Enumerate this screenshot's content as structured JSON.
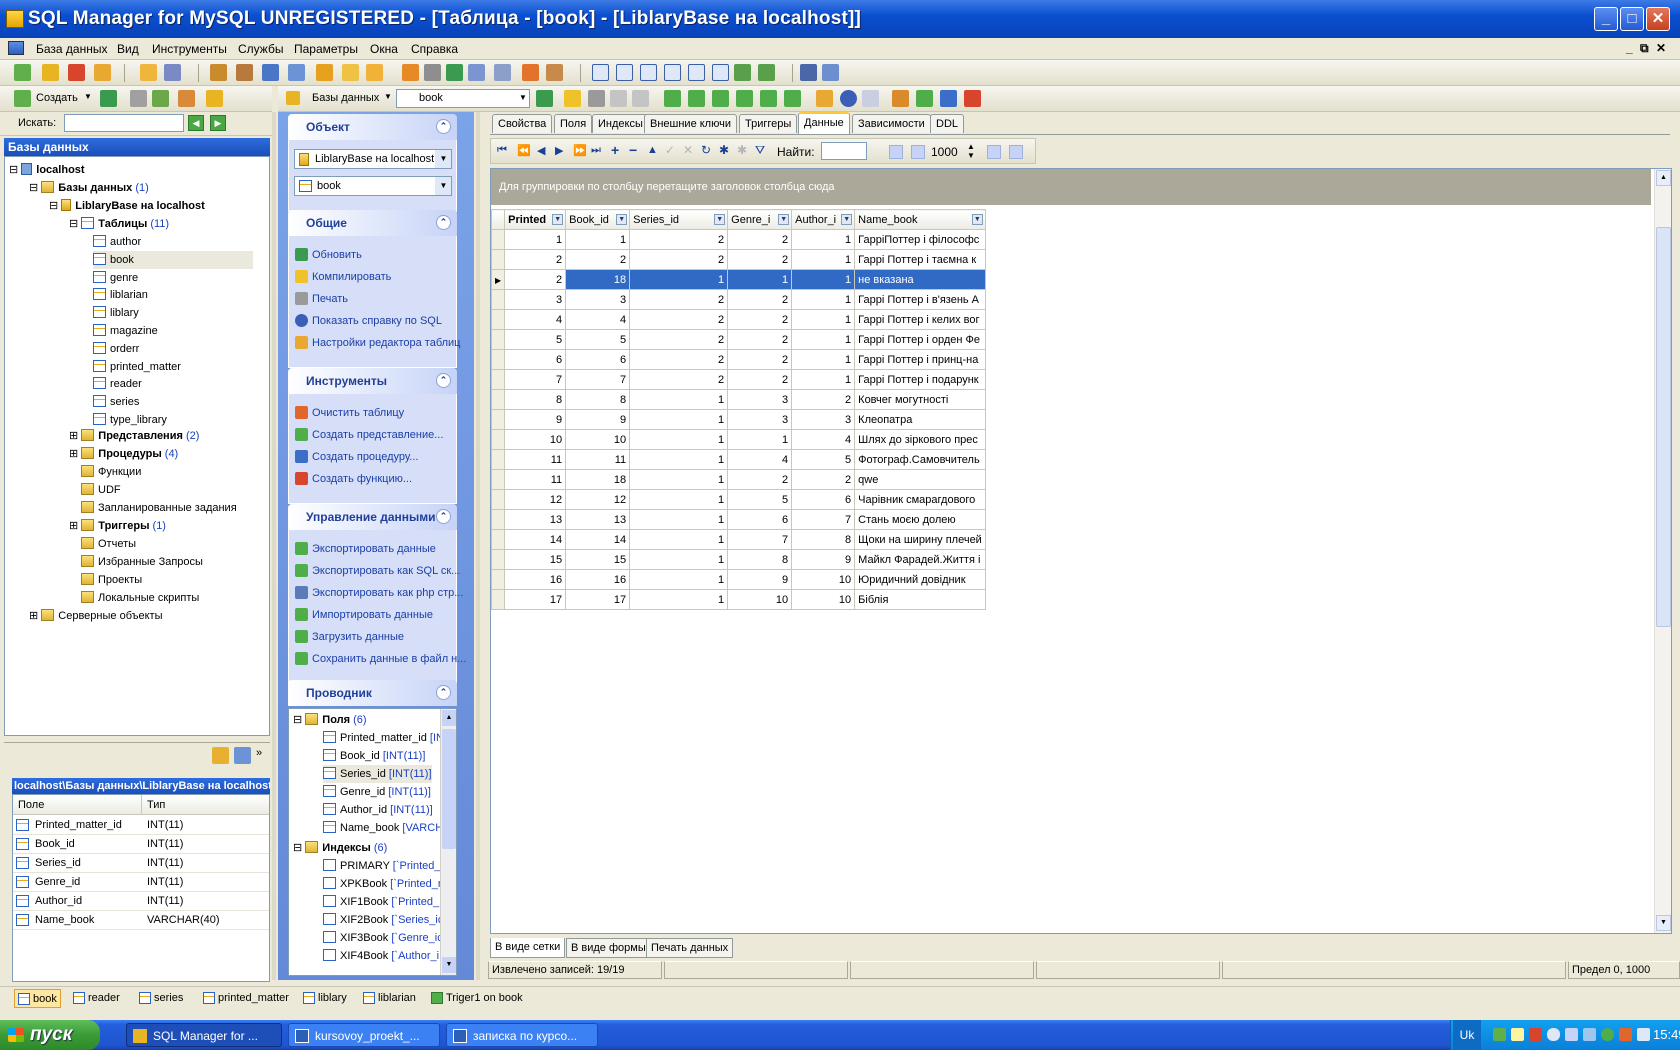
{
  "window": {
    "title": "SQL Manager for MySQL UNREGISTERED - [Таблица - [book] - [LiblaryBase на localhost]]"
  },
  "menu": [
    "База данных",
    "Вид",
    "Инструменты",
    "Службы",
    "Параметры",
    "Окна",
    "Справка"
  ],
  "toolbar2": {
    "create_label": "Создать",
    "db_select": "Базы данных",
    "table_select": "book"
  },
  "search": {
    "label": "Искать:",
    "value": ""
  },
  "db_panel": {
    "title": "Базы данных",
    "tree": {
      "host": "localhost",
      "databases": "Базы данных",
      "databases_count": "(1)",
      "db": "LiblaryBase на localhost",
      "tables": "Таблицы",
      "tables_count": "(11)",
      "table_list": [
        "author",
        "book",
        "genre",
        "liblarian",
        "liblary",
        "magazine",
        "orderr",
        "printed_matter",
        "reader",
        "series",
        "type_library"
      ],
      "views": "Представления",
      "views_count": "(2)",
      "procedures": "Процедуры",
      "procedures_count": "(4)",
      "functions": "Функции",
      "udf": "UDF",
      "scheduled": "Запланированные задания",
      "triggers": "Триггеры",
      "triggers_count": "(1)",
      "reports": "Отчеты",
      "favorites": "Избранные Запросы",
      "projects": "Проекты",
      "scripts": "Локальные скрипты",
      "server_objects": "Серверные объекты"
    }
  },
  "fields_panel": {
    "path": "localhost\\Базы данных\\LiblaryBase на localhost",
    "col_field": "Поле",
    "col_type": "Тип",
    "rows": [
      {
        "name": "Printed_matter_id",
        "type": "INT(11)"
      },
      {
        "name": "Book_id",
        "type": "INT(11)"
      },
      {
        "name": "Series_id",
        "type": "INT(11)"
      },
      {
        "name": "Genre_id",
        "type": "INT(11)"
      },
      {
        "name": "Author_id",
        "type": "INT(11)"
      },
      {
        "name": "Name_book",
        "type": "VARCHAR(40)"
      }
    ]
  },
  "taskpane": {
    "object": {
      "title": "Объект",
      "db": "LiblaryBase на localhost",
      "table": "book"
    },
    "general": {
      "title": "Общие",
      "links": [
        "Обновить",
        "Компилировать",
        "Печать",
        "Показать справку по  SQL",
        "Настройки редактора таблиц"
      ]
    },
    "tools": {
      "title": "Инструменты",
      "links": [
        "Очистить таблицу",
        "Создать представление...",
        "Создать процедуру...",
        "Создать функцию..."
      ]
    },
    "data": {
      "title": "Управление данными",
      "links": [
        "Экспортировать данные",
        "Экспортировать как SQL ск...",
        "Экспортировать как php стр...",
        "Импортировать данные",
        "Загрузить данные",
        "Сохранить данные в файл н..."
      ]
    },
    "explorer": {
      "title": "Проводник",
      "fields_label": "Поля",
      "fields_count": "(6)",
      "fields": [
        {
          "name": "Printed_matter_id",
          "type": "[IN"
        },
        {
          "name": "Book_id",
          "type": "[INT(11)]"
        },
        {
          "name": "Series_id",
          "type": "[INT(11)]"
        },
        {
          "name": "Genre_id",
          "type": "[INT(11)]"
        },
        {
          "name": "Author_id",
          "type": "[INT(11)]"
        },
        {
          "name": "Name_book",
          "type": "[VARCH"
        }
      ],
      "indexes_label": "Индексы",
      "indexes_count": "(6)",
      "indexes": [
        {
          "name": "PRIMARY",
          "cols": "[`Printed_"
        },
        {
          "name": "XPKBook",
          "cols": "[`Printed_r"
        },
        {
          "name": "XIF1Book",
          "cols": "[`Printed_"
        },
        {
          "name": "XIF2Book",
          "cols": "[`Series_ic"
        },
        {
          "name": "XIF3Book",
          "cols": "[`Genre_ic"
        },
        {
          "name": "XIF4Book",
          "cols": "[`Author_i"
        }
      ]
    }
  },
  "tabs": [
    "Свойства",
    "Поля",
    "Индексы",
    "Внешние ключи",
    "Триггеры",
    "Данные",
    "Зависимости",
    "DDL"
  ],
  "active_tab": "Данные",
  "nav": {
    "find_label": "Найти:",
    "find_value": "",
    "limit": "1000"
  },
  "grid": {
    "group_hint": "Для группировки по столбцу перетащите заголовок столбца сюда",
    "columns": [
      "Printed",
      "Book_id",
      "Series_id",
      "Genre_i",
      "Author_i",
      "Name_book"
    ],
    "rows": [
      [
        "1",
        "1",
        "2",
        "2",
        "1",
        "ГарріПоттер і філософс"
      ],
      [
        "2",
        "2",
        "2",
        "2",
        "1",
        "Гаррі Поттер і таємна к"
      ],
      [
        "2",
        "18",
        "1",
        "1",
        "1",
        "не вказана"
      ],
      [
        "3",
        "3",
        "2",
        "2",
        "1",
        "Гаррі Поттер і в'язень А"
      ],
      [
        "4",
        "4",
        "2",
        "2",
        "1",
        "Гаррі Поттер і келих вог"
      ],
      [
        "5",
        "5",
        "2",
        "2",
        "1",
        "Гаррі Поттер і орден Фе"
      ],
      [
        "6",
        "6",
        "2",
        "2",
        "1",
        "Гаррі Поттер і принц-на"
      ],
      [
        "7",
        "7",
        "2",
        "2",
        "1",
        "Гаррі Поттер і подарунк"
      ],
      [
        "8",
        "8",
        "1",
        "3",
        "2",
        "Ковчег могутності"
      ],
      [
        "9",
        "9",
        "1",
        "3",
        "3",
        "Клеопатра"
      ],
      [
        "10",
        "10",
        "1",
        "1",
        "4",
        "Шлях до зіркового прес"
      ],
      [
        "11",
        "11",
        "1",
        "4",
        "5",
        "Фотограф.Самовчитель"
      ],
      [
        "11",
        "18",
        "1",
        "2",
        "2",
        "qwe"
      ],
      [
        "12",
        "12",
        "1",
        "5",
        "6",
        "Чарівник смарагдового"
      ],
      [
        "13",
        "13",
        "1",
        "6",
        "7",
        "Стань моєю долею"
      ],
      [
        "14",
        "14",
        "1",
        "7",
        "8",
        "Щоки на ширину плечей"
      ],
      [
        "15",
        "15",
        "1",
        "8",
        "9",
        "Майкл Фарадей.Життя і"
      ],
      [
        "16",
        "16",
        "1",
        "9",
        "10",
        "Юридичний довідник"
      ],
      [
        "17",
        "17",
        "1",
        "10",
        "10",
        "Біблія"
      ]
    ],
    "selected_row": 2
  },
  "view_tabs": [
    "В виде сетки",
    "В виде формы",
    "Печать данных"
  ],
  "status": {
    "records": "Извлечено записей: 19/19",
    "limit": "Предел 0, 1000"
  },
  "window_tabs": [
    "book",
    "reader",
    "series",
    "printed_matter",
    "liblary",
    "liblarian",
    "Triger1 on book"
  ],
  "taskbar": {
    "start": "пуск",
    "tasks": [
      "SQL Manager for ...",
      "kursovoy_proekt_...",
      "записка по курсо..."
    ],
    "lang": "Uk",
    "clock": "15:49"
  },
  "colors": {
    "accent": "#316ac5",
    "titlebar": "#0a4fd0",
    "taskbar": "#245edb"
  }
}
